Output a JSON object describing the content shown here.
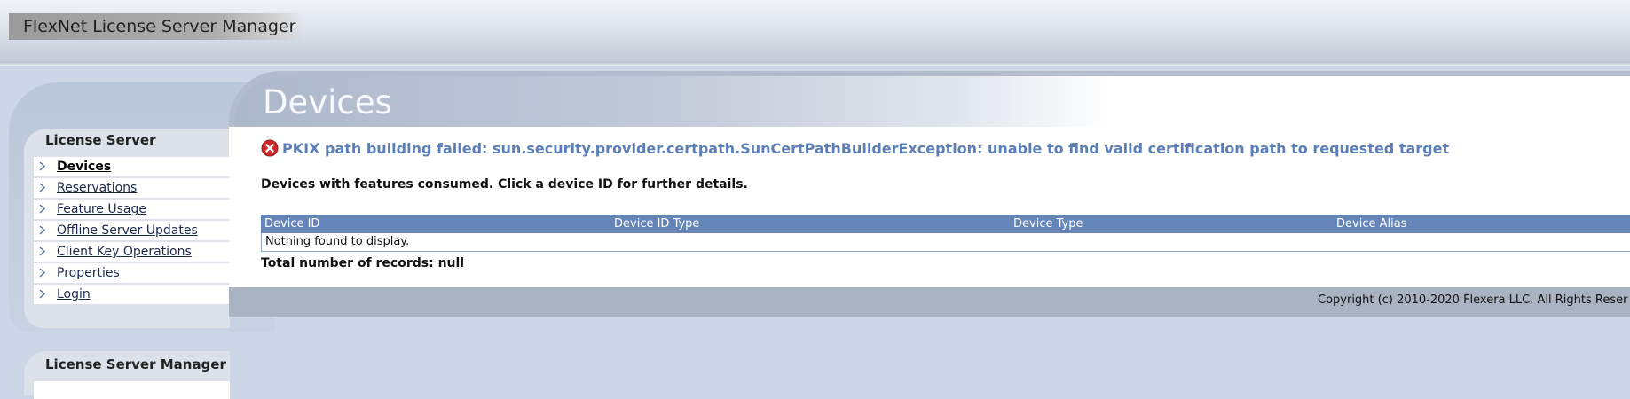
{
  "app": {
    "title": "FlexNet License Server Manager"
  },
  "sidebar": {
    "section_title": "License Server",
    "items": [
      {
        "label": "Devices",
        "active": true
      },
      {
        "label": "Reservations"
      },
      {
        "label": "Feature Usage"
      },
      {
        "label": "Offline Server Updates"
      },
      {
        "label": "Client Key Operations"
      },
      {
        "label": "Properties"
      },
      {
        "label": "Login"
      }
    ],
    "section2_title": "License Server Manager"
  },
  "main": {
    "page_title": "Devices",
    "error_icon": "error-icon",
    "error_message": "PKIX path building failed: sun.security.provider.certpath.SunCertPathBuilderException: unable to find valid certification path to requested target",
    "subtitle": "Devices with features consumed. Click a device ID for further details.",
    "table": {
      "columns": [
        "Device ID",
        "Device ID Type",
        "Device Type",
        "Device Alias"
      ],
      "empty_message": "Nothing found to display."
    },
    "total_records": "Total number of records: null"
  },
  "footer": {
    "copyright": "Copyright (c) 2010-2020 Flexera LLC. All Rights Reser"
  },
  "colors": {
    "header_accent": "#6585b8",
    "error_text": "#5b7fb9",
    "error_icon": "#cc2b2b",
    "background": "#cdd6e6"
  }
}
